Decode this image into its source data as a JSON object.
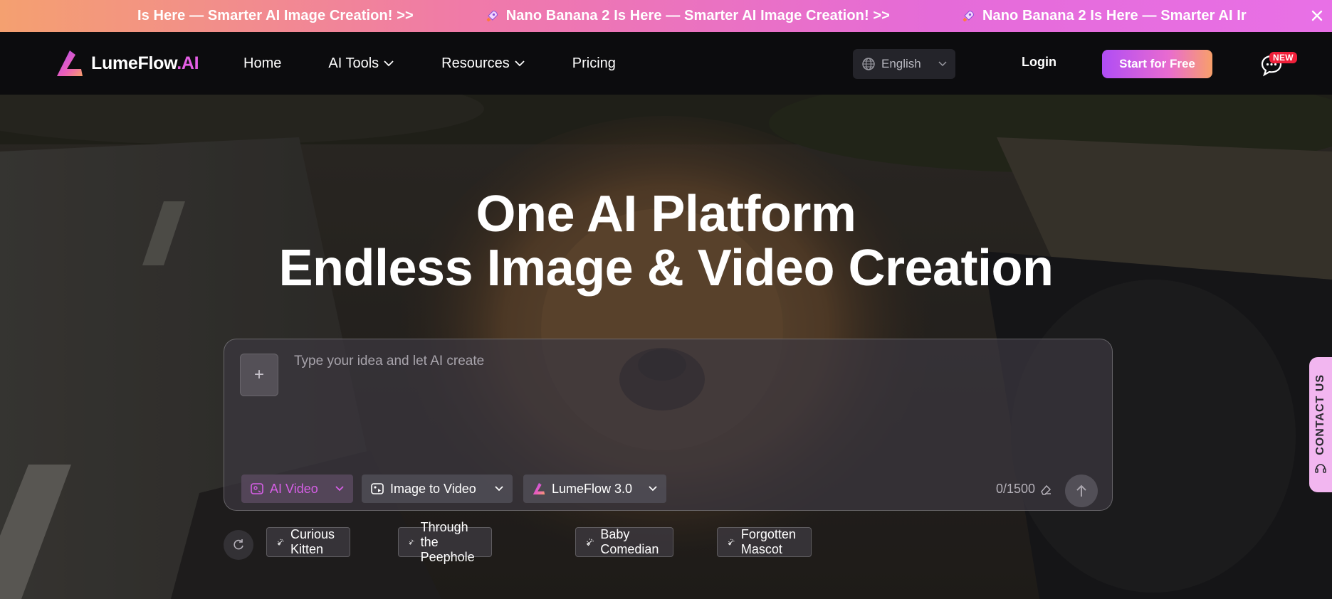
{
  "announcement": {
    "items": [
      "Is Here — Smarter AI Image Creation! >>",
      "Nano Banana 2 Is Here — Smarter AI Image Creation! >>",
      "Nano Banana 2 Is Here — Smarter AI Ir"
    ]
  },
  "nav": {
    "logo_main": "LumeFlow",
    "logo_suffix": ".AI",
    "links": [
      "Home",
      "AI Tools",
      "Resources",
      "Pricing"
    ],
    "language": "English",
    "login": "Login",
    "start": "Start for Free",
    "new_badge": "NEW"
  },
  "hero": {
    "title_line1": "One AI Platform",
    "title_line2": "Endless Image & Video Creation"
  },
  "prompt": {
    "placeholder": "Type your idea and let AI create",
    "upload": "+",
    "mode": "AI Video",
    "type": "Image to Video",
    "model": "LumeFlow 3.0",
    "counter": "0/1500"
  },
  "suggestions": [
    "Curious Kitten",
    "Through the Peephole",
    "Baby Comedian",
    "Forgotten Mascot"
  ],
  "contact": "CONTACT US",
  "colors": {
    "accent": "#e55fe6",
    "announce_from": "#f4a070",
    "announce_to": "#e870e6",
    "badge": "#f0203a"
  }
}
